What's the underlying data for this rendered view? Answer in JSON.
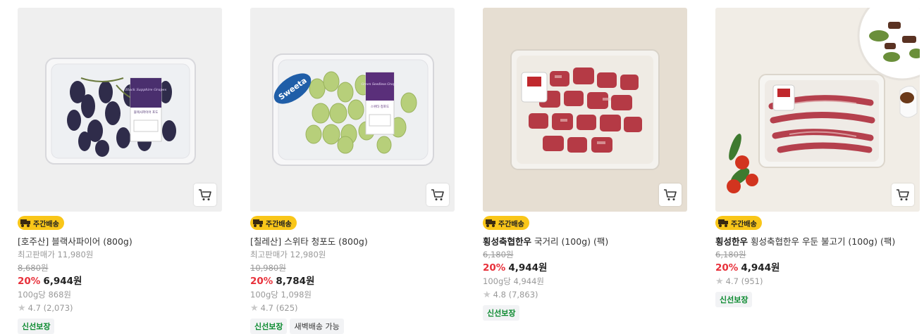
{
  "products": [
    {
      "badge": "주간배송",
      "name_bold": "",
      "name": "[호주산] 블랙사파이어 (800g)",
      "top_price_label": "최고판매가 11,980원",
      "original_price": "8,680원",
      "discount": "20%",
      "price": "6,944원",
      "unit_price": "100g당 868원",
      "rating": "4.7 (2,073)",
      "tags": [
        "신선보장"
      ],
      "label_text": "Black Sapphire Grapes",
      "label_sub": "블랙사파이어 포도"
    },
    {
      "badge": "주간배송",
      "name_bold": "",
      "name": "[칠레산] 스위타 청포도 (800g)",
      "top_price_label": "최고판매가 12,980원",
      "original_price": "10,980원",
      "discount": "20%",
      "price": "8,784원",
      "unit_price": "100g당 1,098원",
      "rating": "4.7 (625)",
      "tags": [
        "신선보장",
        "새벽배송 가능"
      ],
      "label_text": "Green Seedless Grapes",
      "label_sub": "스위타 청포도",
      "brand": "Sweeta"
    },
    {
      "badge": "주간배송",
      "name_bold": "횡성축협한우",
      "name": "국거리 (100g) (팩)",
      "top_price_label": "",
      "original_price": "6,180원",
      "discount": "20%",
      "price": "4,944원",
      "unit_price": "100g당 4,944원",
      "rating": "4.8 (7,863)",
      "tags": [
        "신선보장"
      ]
    },
    {
      "badge": "주간배송",
      "name_bold": "횡성한우",
      "name": "횡성축협한우 우둔 불고기 (100g) (팩)",
      "top_price_label": "",
      "original_price": "6,180원",
      "discount": "20%",
      "price": "4,944원",
      "unit_price": "",
      "rating": "4.7 (951)",
      "tags": [
        "신선보장"
      ]
    }
  ],
  "colors": {
    "badge": "#f9c619",
    "discount": "#e8313b",
    "fresh_tag": "#0b8a2f"
  },
  "icons": {
    "cart": "cart-icon",
    "truck": "truck-icon",
    "star": "star-icon"
  }
}
